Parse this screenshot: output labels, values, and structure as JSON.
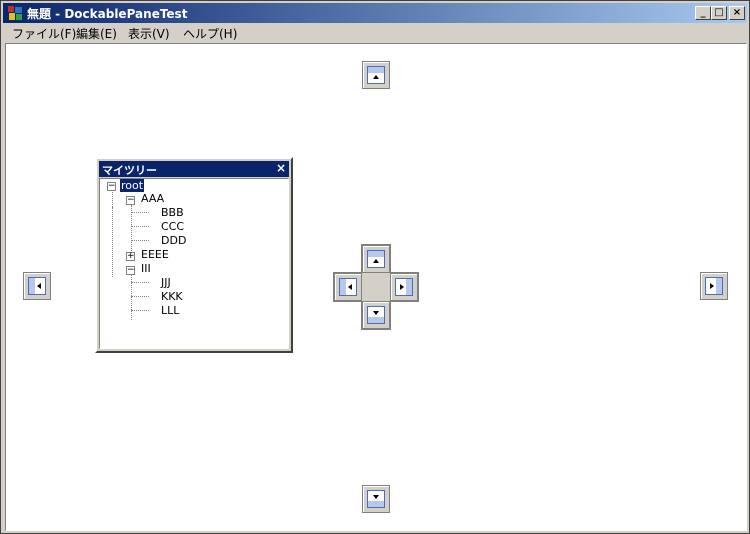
{
  "window": {
    "title": "無題 - DockablePaneTest"
  },
  "caption_buttons": {
    "minimize": "_",
    "maximize": "□",
    "close": "×"
  },
  "menu": {
    "items": [
      "ファイル(F)",
      "編集(E)",
      "表示(V)",
      "ヘルプ(H)"
    ]
  },
  "pane": {
    "title": "マイツリー",
    "close": "×",
    "tree": {
      "root": "root",
      "nodes": [
        "AAA",
        "BBB",
        "CCC",
        "DDD",
        "EEEE",
        "III",
        "JJJ",
        "KKK",
        "LLL"
      ],
      "expanders": {
        "root": "−",
        "AAA": "−",
        "EEEE": "+",
        "III": "−"
      }
    }
  },
  "colors": {
    "titlebar_start": "#0a246a",
    "titlebar_end": "#a6caf0",
    "dock_accent": "#4a6fb8"
  }
}
